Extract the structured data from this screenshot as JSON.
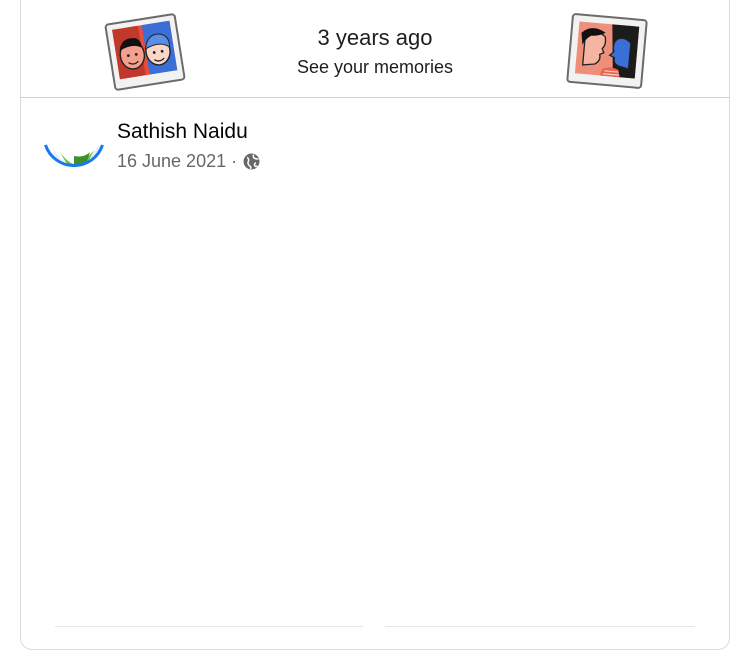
{
  "memories": {
    "title": "3 years ago",
    "subtitle": "See your memories"
  },
  "post": {
    "author": "Sathish Naidu",
    "date": "16 June 2021",
    "separator": "·",
    "privacy_icon": "globe-icon"
  },
  "colors": {
    "accent_blue": "#1877f2",
    "text_secondary": "#65676b",
    "divider": "#e4e6eb"
  }
}
